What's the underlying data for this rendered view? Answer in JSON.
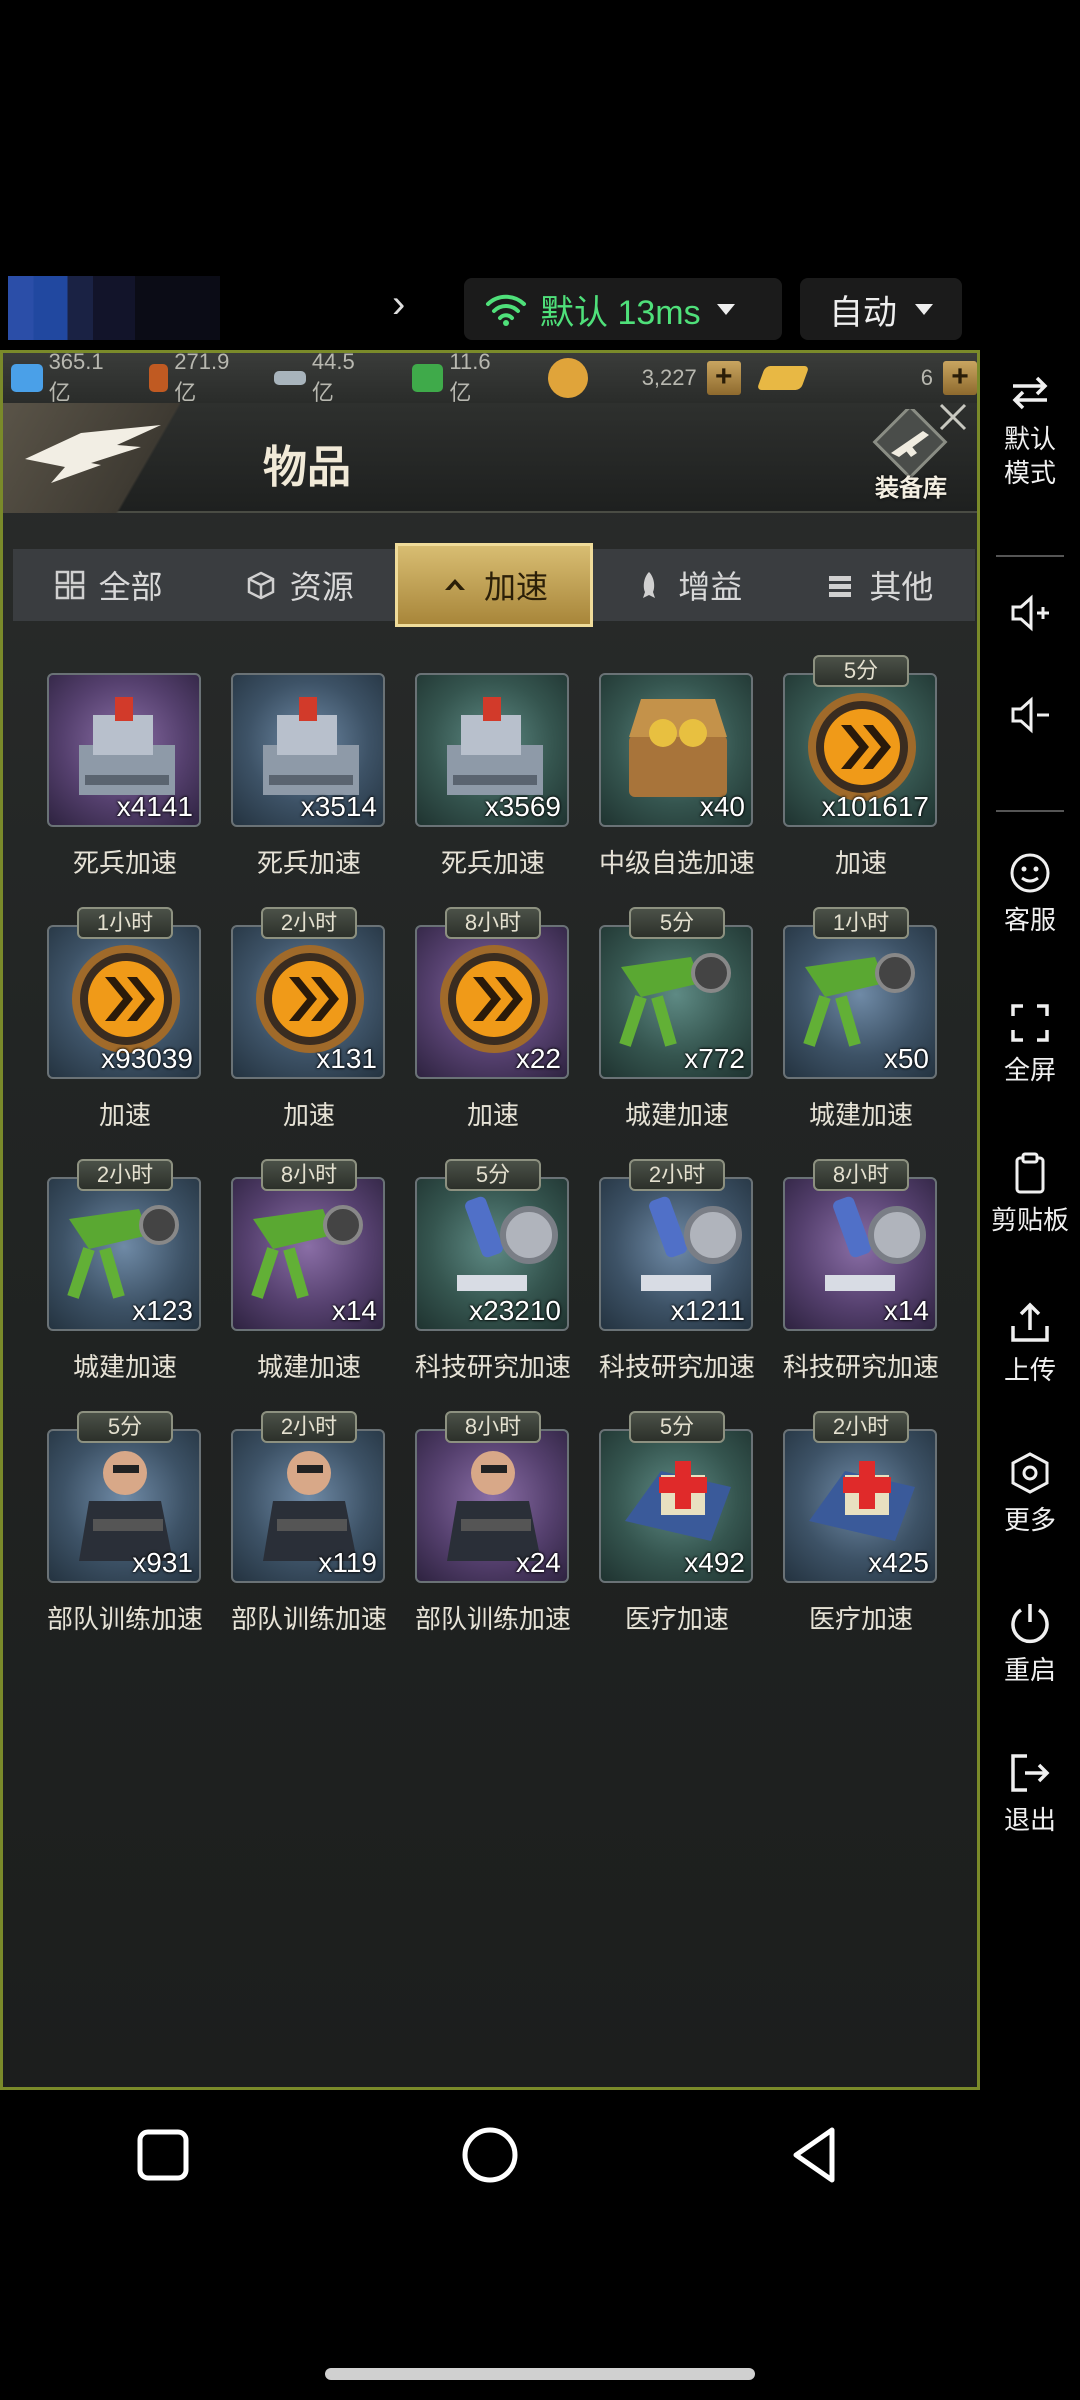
{
  "topbar": {
    "network_label": "默认 13ms",
    "mode_label": "自动"
  },
  "resources": [
    {
      "value": "365.1亿",
      "icon": "crystal-icon",
      "color": "#4aa0e8"
    },
    {
      "value": "271.9亿",
      "icon": "oil-barrel-icon",
      "color": "#c05a22"
    },
    {
      "value": "44.5亿",
      "icon": "steel-icon",
      "color": "#a8b4bc"
    },
    {
      "value": "11.6亿",
      "icon": "cash-icon",
      "color": "#3faa4a"
    },
    {
      "value": "3,227",
      "icon": "gold-coin-icon",
      "color": "#e0a43a"
    },
    {
      "value": "6",
      "icon": "gold-bar-icon",
      "color": "#e8b844"
    }
  ],
  "header": {
    "title": "物品",
    "armory_label": "装备库"
  },
  "tabs": [
    {
      "label": "全部",
      "icon": "grid-icon",
      "active": false
    },
    {
      "label": "资源",
      "icon": "cube-icon",
      "active": false
    },
    {
      "label": "加速",
      "icon": "chevron-up-icon",
      "active": true
    },
    {
      "label": "增益",
      "icon": "rocket-icon",
      "active": false
    },
    {
      "label": "其他",
      "icon": "stack-icon",
      "active": false
    }
  ],
  "items": [
    {
      "name": "死兵加速",
      "count": "x4141",
      "badge": "",
      "art": "hospital-building",
      "bg": "purple"
    },
    {
      "name": "死兵加速",
      "count": "x3514",
      "badge": "",
      "art": "hospital-building",
      "bg": "blue"
    },
    {
      "name": "死兵加速",
      "count": "x3569",
      "badge": "",
      "art": "hospital-building",
      "bg": "teal"
    },
    {
      "name": "中级自选加速",
      "count": "x40",
      "badge": "",
      "art": "treasure-chest",
      "bg": "teal"
    },
    {
      "name": "加速",
      "count": "x101617",
      "badge": "5分",
      "art": "speedup-coin",
      "bg": "teal"
    },
    {
      "name": "加速",
      "count": "x93039",
      "badge": "1小时",
      "art": "speedup-coin",
      "bg": "blue"
    },
    {
      "name": "加速",
      "count": "x131",
      "badge": "2小时",
      "art": "speedup-coin",
      "bg": "blue"
    },
    {
      "name": "加速",
      "count": "x22",
      "badge": "8小时",
      "art": "speedup-coin",
      "bg": "purple"
    },
    {
      "name": "城建加速",
      "count": "x772",
      "badge": "5分",
      "art": "build-claw",
      "bg": "teal"
    },
    {
      "name": "城建加速",
      "count": "x50",
      "badge": "1小时",
      "art": "build-claw",
      "bg": "blue"
    },
    {
      "name": "城建加速",
      "count": "x123",
      "badge": "2小时",
      "art": "build-claw",
      "bg": "blue"
    },
    {
      "name": "城建加速",
      "count": "x14",
      "badge": "8小时",
      "art": "build-claw",
      "bg": "purple"
    },
    {
      "name": "科技研究加速",
      "count": "x23210",
      "badge": "5分",
      "art": "microscope",
      "bg": "teal"
    },
    {
      "name": "科技研究加速",
      "count": "x1211",
      "badge": "2小时",
      "art": "microscope",
      "bg": "blue"
    },
    {
      "name": "科技研究加速",
      "count": "x14",
      "badge": "8小时",
      "art": "microscope",
      "bg": "purple"
    },
    {
      "name": "部队训练加速",
      "count": "x931",
      "badge": "5分",
      "art": "soldier",
      "bg": "blue"
    },
    {
      "name": "部队训练加速",
      "count": "x119",
      "badge": "2小时",
      "art": "soldier",
      "bg": "blue"
    },
    {
      "name": "部队训练加速",
      "count": "x24",
      "badge": "8小时",
      "art": "soldier",
      "bg": "purple"
    },
    {
      "name": "医疗加速",
      "count": "x492",
      "badge": "5分",
      "art": "medical-kit",
      "bg": "teal"
    },
    {
      "name": "医疗加速",
      "count": "x425",
      "badge": "2小时",
      "art": "medical-kit",
      "bg": "blue"
    }
  ],
  "sidepanel": [
    {
      "label": "默认\n模式",
      "icon": "swap-icon"
    },
    {
      "label": "",
      "icon": "volume-up-icon"
    },
    {
      "label": "",
      "icon": "volume-down-icon"
    },
    {
      "label": "客服",
      "icon": "support-icon"
    },
    {
      "label": "全屏",
      "icon": "fullscreen-icon"
    },
    {
      "label": "剪贴板",
      "icon": "clipboard-icon"
    },
    {
      "label": "上传",
      "icon": "upload-icon"
    },
    {
      "label": "更多",
      "icon": "more-icon"
    },
    {
      "label": "重启",
      "icon": "power-icon"
    },
    {
      "label": "退出",
      "icon": "exit-icon"
    }
  ],
  "colors": {
    "accent_gold": "#d8bd72",
    "network_green": "#4fe07a",
    "frame_border": "#7a8a2a"
  }
}
